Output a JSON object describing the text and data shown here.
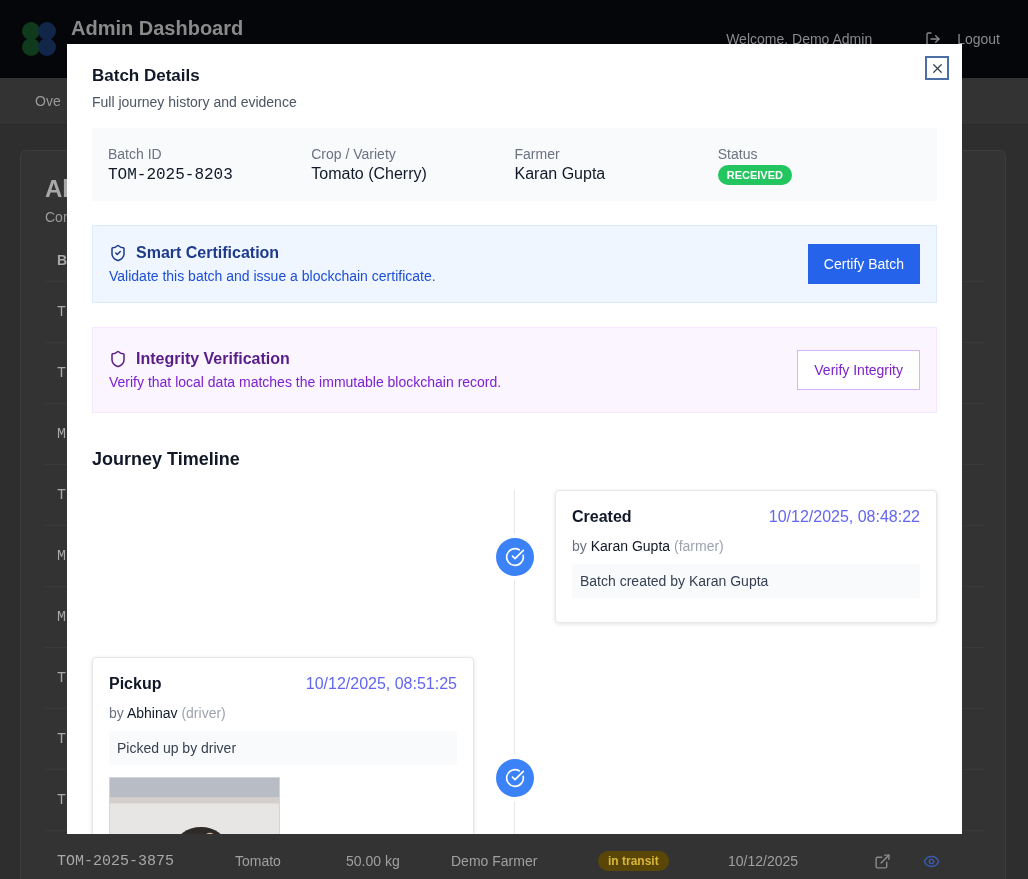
{
  "background": {
    "header": {
      "title": "Admin Dashboard",
      "welcome": "Welcome, Demo Admin",
      "logout": "Logout"
    },
    "nav": {
      "item": "Ove"
    },
    "panel": {
      "title": "Al",
      "subtitle": "Cor",
      "column_1": "B",
      "rows": [
        {
          "batch": "T"
        },
        {
          "batch": "T"
        },
        {
          "batch": "M"
        },
        {
          "batch": "T"
        },
        {
          "batch": "M"
        },
        {
          "batch": "M"
        },
        {
          "batch": "T"
        },
        {
          "batch": "T"
        },
        {
          "batch": "T"
        },
        {
          "batch": "TOM-2025-3875",
          "crop": "Tomato",
          "quantity": "50.00 kg",
          "farmer": "Demo Farmer",
          "status": {
            "label": "in transit",
            "color": "#5a4708"
          },
          "date": "10/12/2025"
        }
      ]
    }
  },
  "modal": {
    "title": "Batch Details",
    "subtitle": "Full journey history and evidence",
    "summary": [
      {
        "label": "Batch ID",
        "value": "TOM-2025-8203",
        "kind": "code"
      },
      {
        "label": "Crop / Variety",
        "value": "Tomato (Cherry)",
        "kind": "text"
      },
      {
        "label": "Farmer",
        "value": "Karan Gupta",
        "kind": "text"
      },
      {
        "label": "Status",
        "value": "RECEIVED",
        "kind": "badge",
        "color": "#22c55e"
      }
    ],
    "actions": [
      {
        "kind": "certify",
        "title": "Smart Certification",
        "description": "Validate this batch and issue a blockchain certificate.",
        "button": "Certify Batch"
      },
      {
        "kind": "integrity",
        "title": "Integrity Verification",
        "description": "Verify that local data matches the immutable blockchain record.",
        "button": "Verify Integrity"
      }
    ],
    "timeline": {
      "title": "Journey Timeline",
      "events": [
        {
          "title": "Created",
          "time": "10/12/2025, 08:48:22",
          "by": "by",
          "actor": "Karan Gupta",
          "role": "(farmer)",
          "note": "Batch created by Karan Gupta"
        },
        {
          "title": "Pickup",
          "time": "10/12/2025, 08:51:25",
          "by": "by",
          "actor": "Abhinav",
          "role": "(driver)",
          "note": "Picked up by driver"
        }
      ]
    }
  }
}
